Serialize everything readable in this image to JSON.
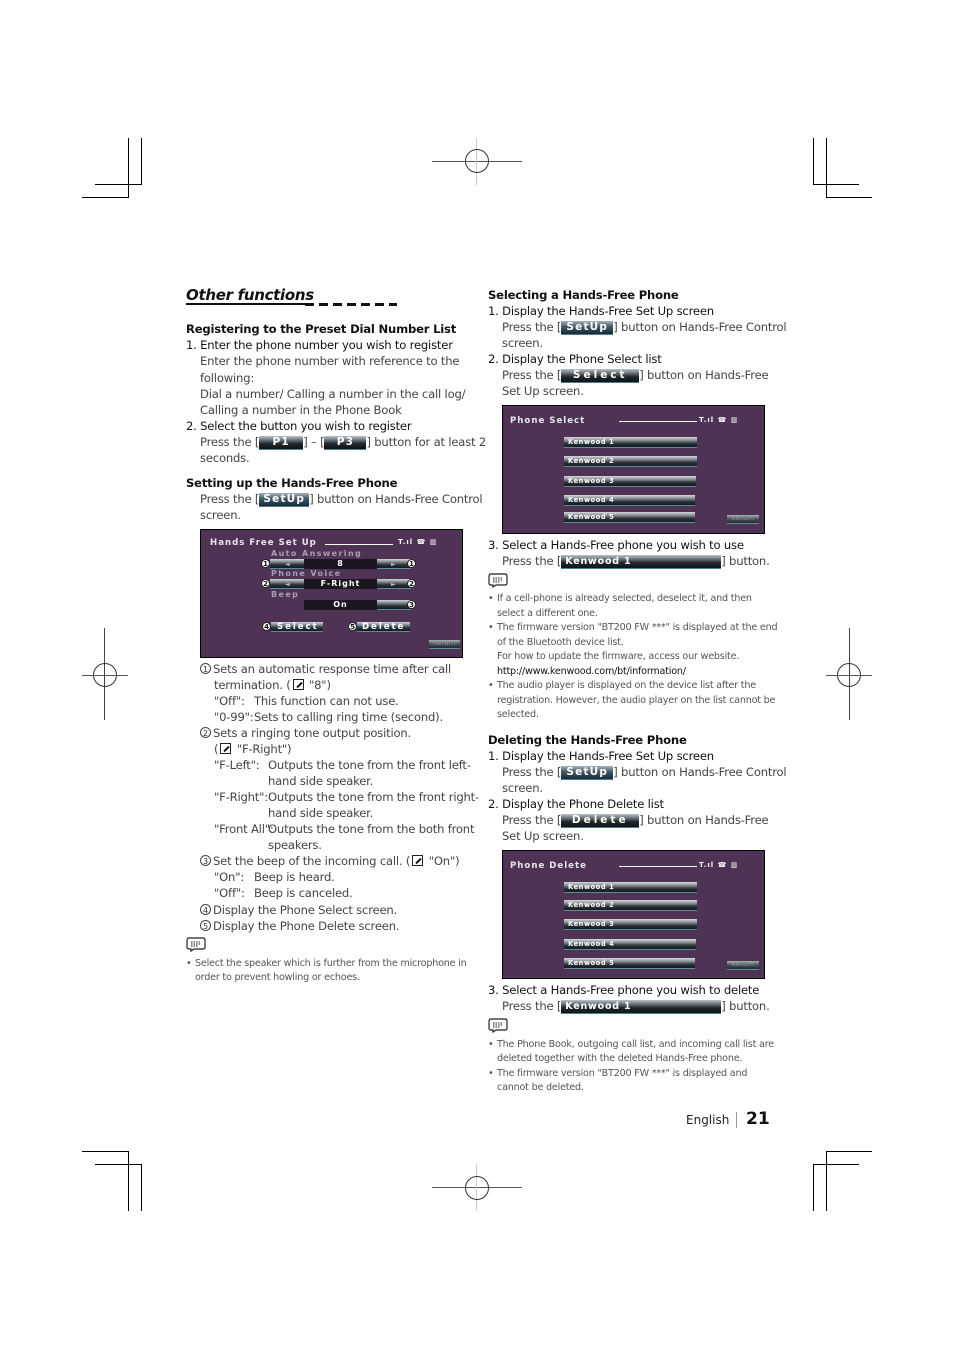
{
  "page": {
    "section_title": "Other functions",
    "footer": {
      "language": "English",
      "page_number": "21"
    }
  },
  "left": {
    "registering": {
      "heading": "Registering to the Preset Dial Number List",
      "step1_title": "1.  Enter the phone number you wish to register",
      "step1_lines": [
        "Enter the phone number with reference to the",
        "following:",
        "Dial a number/ Calling a number in the call log/",
        "Calling a number in the Phone Book"
      ],
      "step2_title": "2.  Select the button you wish to register",
      "step2_pre": "Press the  [",
      "step2_btn1": "P1",
      "step2_mid": "] – [",
      "step2_btn2": "P3",
      "step2_post": "] button for at least 2",
      "step2_line2": "seconds."
    },
    "setting_up": {
      "heading": "Setting up the Hands-Free Phone",
      "pre": "Press the [",
      "button": "SetUp",
      "post": "] button on Hands-Free Control",
      "line2": "screen."
    },
    "setup_screen": {
      "title": "Hands  Free  Set  Up",
      "status_icons": "T.ıl  ☎ ▥",
      "auto_answering_label": "Auto Answering",
      "auto_answering_value": "8",
      "phone_voice_label": "Phone Voice",
      "phone_voice_value": "F-Right",
      "beep_label": "Beep",
      "beep_value": "On",
      "select_button": "Select",
      "delete_button": "Delete",
      "return_button": "Return",
      "callout_numbers": [
        "1",
        "2",
        "3",
        "4",
        "5"
      ],
      "arrow_left": "◄",
      "arrow_right": "►"
    },
    "explanations": {
      "item1_num": "1",
      "item1_line1": "Sets an automatic response time after call",
      "item1_line2_pre": "termination. (",
      "item1_line2_post": " \"8\")",
      "item1_options": [
        {
          "key": "\"Off\":",
          "desc": "This function can not use."
        },
        {
          "key": "\"0-99\":",
          "desc": "Sets to calling ring time (second)."
        }
      ],
      "item2_num": "2",
      "item2_line1": "Sets a ringing tone output position.",
      "item2_line2_pre": "(",
      "item2_line2_post": " \"F-Right\")",
      "item2_options": [
        {
          "key": "\"F-Left\":",
          "desc": "Outputs the tone from the front left-",
          "desc2": "hand side speaker."
        },
        {
          "key": "\"F-Right\":",
          "desc": "Outputs the tone from the front right-",
          "desc2": "hand side speaker."
        },
        {
          "key": "\"Front All\":",
          "desc": "Outputs the tone from the both front",
          "desc2": "speakers."
        }
      ],
      "item3_num": "3",
      "item3_pre": "Set the beep of the incoming call.  (",
      "item3_post": " \"On\")",
      "item3_options": [
        {
          "key": "\"On\":",
          "desc": "Beep is heard."
        },
        {
          "key": "\"Off\":",
          "desc": "Beep is canceled."
        }
      ],
      "item4_num": "4",
      "item4": "Display the Phone Select screen.",
      "item5_num": "5",
      "item5": "Display the Phone Delete screen."
    },
    "note": {
      "bullets": [
        [
          "Select the speaker which is further from the microphone in",
          "order to prevent howling or echoes."
        ]
      ]
    }
  },
  "right": {
    "selecting": {
      "heading": "Selecting a Hands-Free Phone",
      "step1_title": "1.  Display the Hands-Free Set Up screen",
      "step1_pre": "Press the [",
      "step1_btn": "SetUp",
      "step1_post": "] button on Hands-Free Control",
      "step1_line2": "screen.",
      "step2_title": "2.  Display the Phone Select list",
      "step2_pre": "Press the [",
      "step2_btn": "Select",
      "step2_post": "] button on Hands-Free",
      "step2_line2": "Set Up screen.",
      "step3_title": "3.  Select a Hands-Free phone you wish to use",
      "step3_pre": "Press the [",
      "step3_btn": "Kenwood 1",
      "step3_post": "] button."
    },
    "select_screen": {
      "title": "Phone Select",
      "items": [
        "Kenwood 1",
        "Kenwood 2",
        "Kenwood 3",
        "Kenwood 4",
        "Kenwood 5"
      ],
      "return_button": "Return"
    },
    "select_note": {
      "b1": [
        "If a cell-phone is already selected, deselect it, and then",
        "select a different one."
      ],
      "b2": [
        "The firmware version \"BT200 FW ***\" is displayed at the end",
        "of the Bluetooth device list.",
        "For how to update the firmware, access our website."
      ],
      "b2_link": "http://www.kenwood.com/bt/information/",
      "b3": [
        "The audio player is displayed on the device list after the",
        "registration. However, the audio player on the list cannot be",
        "selected."
      ]
    },
    "deleting": {
      "heading": "Deleting the Hands-Free Phone",
      "step1_title": "1.  Display the Hands-Free Set Up screen",
      "step1_pre": "Press the [",
      "step1_btn": "SetUp",
      "step1_post": "] button on Hands-Free Control",
      "step1_line2": "screen.",
      "step2_title": "2.  Display the Phone Delete list",
      "step2_pre": "Press the [",
      "step2_btn": "Delete",
      "step2_post": "] button on Hands-Free",
      "step2_line2": "Set Up screen.",
      "step3_title": "3.  Select a Hands-Free phone you wish to delete",
      "step3_pre": "Press the [",
      "step3_btn": "Kenwood 1",
      "step3_post": "] button."
    },
    "delete_screen": {
      "title": "Phone Delete",
      "items": [
        "Kenwood 1",
        "Kenwood 2",
        "Kenwood 3",
        "Kenwood 4",
        "Kenwood 5"
      ],
      "return_button": "Return"
    },
    "delete_note": {
      "b1": [
        "The Phone Book, outgoing call list, and incoming call list are",
        "deleted together with the deleted Hands-Free phone."
      ],
      "b2": [
        "The firmware version \"BT200 FW ***\" is displayed and",
        "cannot be deleted."
      ]
    }
  }
}
